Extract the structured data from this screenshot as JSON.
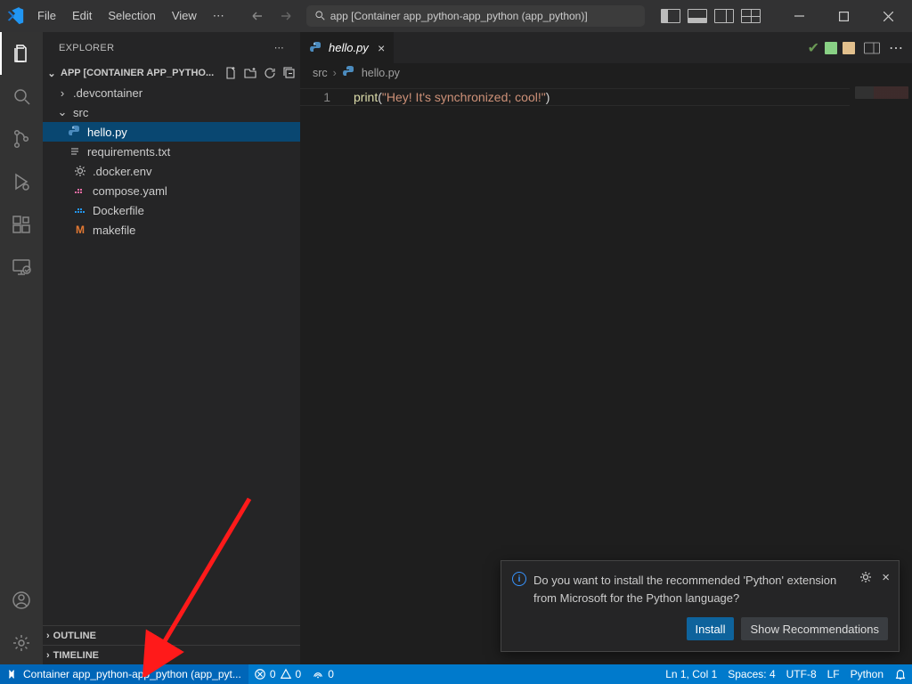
{
  "titlebar": {
    "menus": [
      "File",
      "Edit",
      "Selection",
      "View"
    ],
    "search_text": "app [Container app_python-app_python (app_python)]"
  },
  "activity": {
    "items": [
      "explorer",
      "search",
      "source-control",
      "run",
      "extensions",
      "remote-explorer"
    ],
    "bottom": [
      "accounts",
      "manage"
    ]
  },
  "sidebar": {
    "title": "EXPLORER",
    "project": "APP [CONTAINER APP_PYTHO...",
    "tree": {
      "devcontainer": ".devcontainer",
      "src": "src",
      "hello": "hello.py",
      "req": "requirements.txt",
      "dockerenv": ".docker.env",
      "compose": "compose.yaml",
      "dockerfile": "Dockerfile",
      "makefile": "makefile"
    },
    "outline": "OUTLINE",
    "timeline": "TIMELINE"
  },
  "editor": {
    "tab_label": "hello.py",
    "breadcrumb_root": "src",
    "breadcrumb_file": "hello.py",
    "line_no": "1",
    "code_fn": "print",
    "code_open": "(",
    "code_str": "\"Hey! It's synchronized; cool!\"",
    "code_close": ")"
  },
  "notification": {
    "message": "Do you want to install the recommended 'Python' extension from Microsoft for the Python language?",
    "install": "Install",
    "show": "Show Recommendations"
  },
  "statusbar": {
    "remote": "Container app_python-app_python (app_pyt...",
    "errors": "0",
    "warnings": "0",
    "ports": "0",
    "ln": "Ln 1, Col 1",
    "spaces": "Spaces: 4",
    "encoding": "UTF-8",
    "eol": "LF",
    "lang": "Python"
  }
}
